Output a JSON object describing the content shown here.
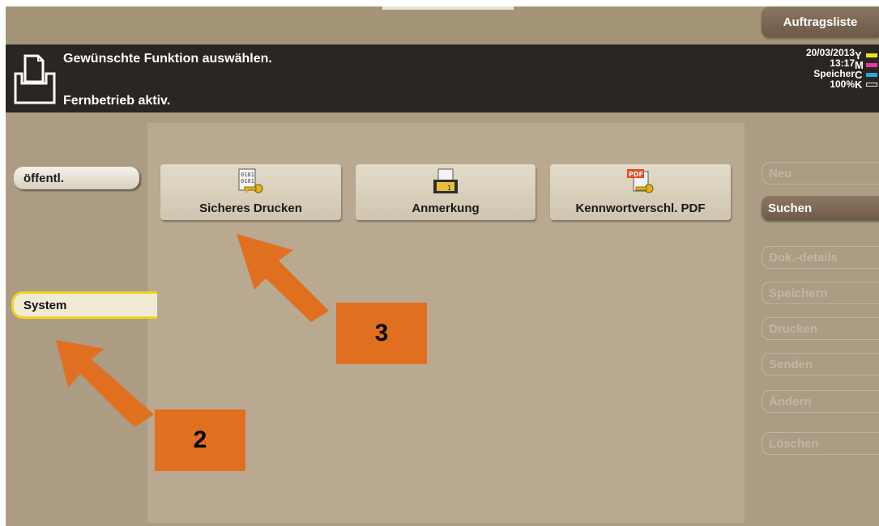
{
  "header": {
    "job_list_label": "Auftragsliste",
    "message_line1": "Gewünschte Funktion auswählen.",
    "message_line2": "Fernbetrieb aktiv.",
    "date": "20/03/2013",
    "time": "13:17",
    "memory_label": "Speicher",
    "memory_value": "100%",
    "toners": [
      {
        "letter": "Y",
        "color": "#f3e21a"
      },
      {
        "letter": "M",
        "color": "#e83aa5"
      },
      {
        "letter": "C",
        "color": "#2aa6e0"
      },
      {
        "letter": "K",
        "color": "#303030"
      }
    ]
  },
  "left_tabs": {
    "public_label": "öffentl.",
    "system_label": "System"
  },
  "functions": [
    {
      "label": "Sicheres Drucken",
      "icon": "secure-print-icon"
    },
    {
      "label": "Anmerkung",
      "icon": "annotation-icon"
    },
    {
      "label": "Kennwortverschl. PDF",
      "icon": "encrypted-pdf-icon"
    }
  ],
  "pdf_icon_text": "PDF",
  "right_buttons": {
    "new": "Neu",
    "search": "Suchen",
    "details": "Dok.-details",
    "save": "Speichern",
    "print": "Drucken",
    "send": "Senden",
    "edit": "Ändern",
    "delete": "Löschen"
  },
  "callouts": {
    "two": "2",
    "three": "3"
  },
  "accent_colors": {
    "callout": "#e07020",
    "system_tab_border": "#f2d21d"
  }
}
